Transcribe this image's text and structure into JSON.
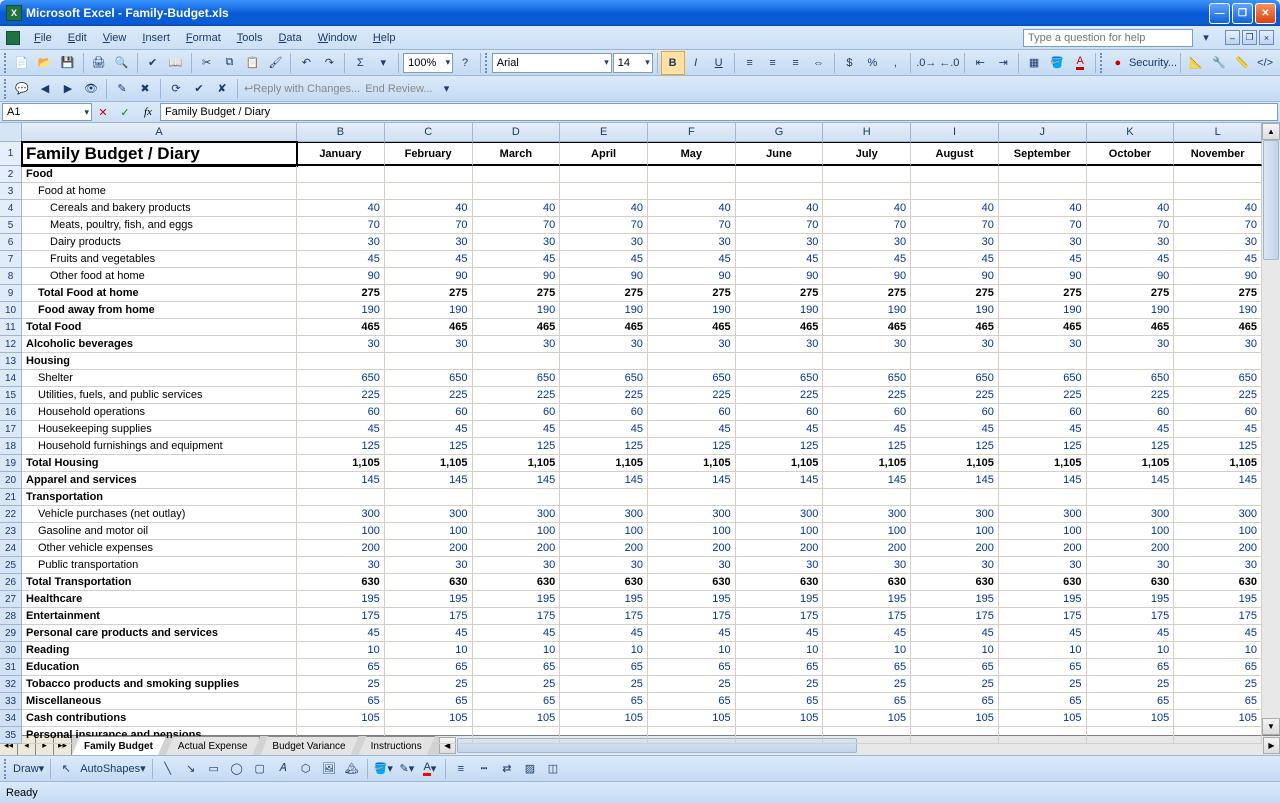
{
  "title": "Microsoft Excel - Family-Budget.xls",
  "menu": [
    "File",
    "Edit",
    "View",
    "Insert",
    "Format",
    "Tools",
    "Data",
    "Window",
    "Help"
  ],
  "helpPlaceholder": "Type a question for help",
  "font": "Arial",
  "fontsize": "14",
  "zoom": "100%",
  "namebox": "A1",
  "formula": "Family Budget / Diary",
  "reviewing": {
    "reply": "Reply with Changes...",
    "end": "End Review..."
  },
  "security": "Security...",
  "columns": [
    "A",
    "B",
    "C",
    "D",
    "E",
    "F",
    "G",
    "H",
    "I",
    "J",
    "K",
    "L"
  ],
  "months": [
    "January",
    "February",
    "March",
    "April",
    "May",
    "June",
    "July",
    "August",
    "September",
    "October",
    "November"
  ],
  "rows": [
    {
      "n": 1,
      "a": "Family Budget / Diary",
      "hdr": true
    },
    {
      "n": 2,
      "a": "Food",
      "bold": true
    },
    {
      "n": 3,
      "a": "Food at home",
      "ind": 1
    },
    {
      "n": 4,
      "a": "Cereals and bakery products",
      "ind": 2,
      "v": 40,
      "blue": true
    },
    {
      "n": 5,
      "a": "Meats, poultry, fish, and eggs",
      "ind": 2,
      "v": 70,
      "blue": true
    },
    {
      "n": 6,
      "a": "Dairy products",
      "ind": 2,
      "v": 30,
      "blue": true
    },
    {
      "n": 7,
      "a": "Fruits and vegetables",
      "ind": 2,
      "v": 45,
      "blue": true
    },
    {
      "n": 8,
      "a": "Other food at home",
      "ind": 2,
      "v": 90,
      "blue": true
    },
    {
      "n": 9,
      "a": "Total Food at home",
      "ind": 1,
      "bold": true,
      "v": 275
    },
    {
      "n": 10,
      "a": "Food away from home",
      "ind": 1,
      "bold": true,
      "v": 190,
      "blue": true
    },
    {
      "n": 11,
      "a": "Total Food",
      "bold": true,
      "v": 465
    },
    {
      "n": 12,
      "a": "Alcoholic beverages",
      "bold": true,
      "v": 30,
      "blue": true
    },
    {
      "n": 13,
      "a": "Housing",
      "bold": true
    },
    {
      "n": 14,
      "a": "Shelter",
      "ind": 1,
      "v": 650,
      "blue": true
    },
    {
      "n": 15,
      "a": "Utilities, fuels, and public services",
      "ind": 1,
      "v": 225,
      "blue": true
    },
    {
      "n": 16,
      "a": "Household operations",
      "ind": 1,
      "v": 60,
      "blue": true
    },
    {
      "n": 17,
      "a": "Housekeeping supplies",
      "ind": 1,
      "v": 45,
      "blue": true
    },
    {
      "n": 18,
      "a": "Household furnishings and equipment",
      "ind": 1,
      "v": 125,
      "blue": true
    },
    {
      "n": 19,
      "a": "Total Housing",
      "bold": true,
      "v": "1,105"
    },
    {
      "n": 20,
      "a": "Apparel and services",
      "bold": true,
      "v": 145,
      "blue": true
    },
    {
      "n": 21,
      "a": "Transportation",
      "bold": true
    },
    {
      "n": 22,
      "a": "Vehicle purchases (net outlay)",
      "ind": 1,
      "v": 300,
      "blue": true
    },
    {
      "n": 23,
      "a": "Gasoline and motor oil",
      "ind": 1,
      "v": 100,
      "blue": true
    },
    {
      "n": 24,
      "a": "Other vehicle expenses",
      "ind": 1,
      "v": 200,
      "blue": true
    },
    {
      "n": 25,
      "a": "Public transportation",
      "ind": 1,
      "v": 30,
      "blue": true
    },
    {
      "n": 26,
      "a": "Total Transportation",
      "bold": true,
      "v": 630
    },
    {
      "n": 27,
      "a": "Healthcare",
      "bold": true,
      "v": 195,
      "blue": true
    },
    {
      "n": 28,
      "a": "Entertainment",
      "bold": true,
      "v": 175,
      "blue": true
    },
    {
      "n": 29,
      "a": "Personal care products and services",
      "bold": true,
      "v": 45,
      "blue": true
    },
    {
      "n": 30,
      "a": "Reading",
      "bold": true,
      "v": 10,
      "blue": true
    },
    {
      "n": 31,
      "a": "Education",
      "bold": true,
      "v": 65,
      "blue": true
    },
    {
      "n": 32,
      "a": "Tobacco products and smoking supplies",
      "bold": true,
      "v": 25,
      "blue": true
    },
    {
      "n": 33,
      "a": "Miscellaneous",
      "bold": true,
      "v": 65,
      "blue": true
    },
    {
      "n": 34,
      "a": "Cash contributions",
      "bold": true,
      "v": 105,
      "blue": true
    },
    {
      "n": 35,
      "a": "Personal insurance and pensions",
      "bold": true
    }
  ],
  "tabs": [
    "Family Budget",
    "Actual Expense",
    "Budget Variance",
    "Instructions"
  ],
  "activeTab": 0,
  "draw": {
    "label": "Draw",
    "autoshapes": "AutoShapes"
  },
  "status": "Ready"
}
